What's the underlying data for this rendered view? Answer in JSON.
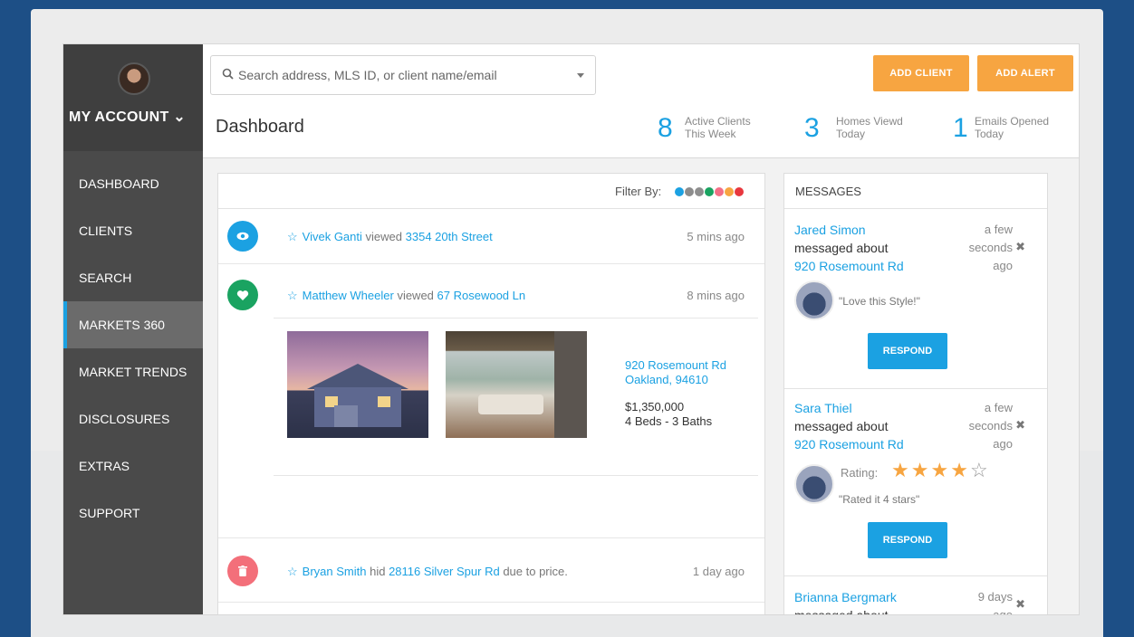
{
  "sidebar": {
    "account_label": "MY ACCOUNT ⌄",
    "items": [
      {
        "label": "DASHBOARD"
      },
      {
        "label": "CLIENTS"
      },
      {
        "label": "SEARCH"
      },
      {
        "label": "MARKETS 360"
      },
      {
        "label": "MARKET TRENDS"
      },
      {
        "label": "DISCLOSURES"
      },
      {
        "label": "EXTRAS"
      },
      {
        "label": "SUPPORT"
      }
    ],
    "active_item": "MARKETS 360"
  },
  "header": {
    "search_placeholder": "Search address, MLS ID, or client name/email",
    "add_client_label": "ADD CLIENT",
    "add_alert_label": "ADD ALERT",
    "page_title": "Dashboard",
    "stats": [
      {
        "value": "8",
        "line1": "Active Clients",
        "line2": "This Week"
      },
      {
        "value": "3",
        "line1": "Homes Viewd",
        "line2": "Today"
      },
      {
        "value": "1",
        "line1": "Emails Opened",
        "line2": "Today"
      }
    ]
  },
  "feed": {
    "filter_label": "Filter By:",
    "filter_colors": [
      "#1ba1e2",
      "#8c8c8c",
      "#8e8e8e",
      "#1aa361",
      "#f36f86",
      "#f7a541",
      "#e8373e"
    ],
    "rows": [
      {
        "name": "Vivek Ganti",
        "action": "viewed",
        "target": "3354 20th Street",
        "suffix": "",
        "time": "5 mins ago",
        "icon": "eye-icon",
        "color": "#1ba1e2"
      },
      {
        "name": "Matthew Wheeler",
        "action": "viewed",
        "target": "67 Rosewood Ln",
        "suffix": "",
        "time": "8 mins ago",
        "icon": "heart-icon",
        "color": "#1aa361"
      },
      {
        "name": "Bryan Smith",
        "action": "hid",
        "target": "28116 Silver Spur Rd",
        "suffix": "due to price.",
        "time": "1 day ago",
        "icon": "trash-icon",
        "color": "#f36f7a"
      }
    ],
    "listing": {
      "address_line1": "920 Rosemount Rd",
      "address_line2": "Oakland, 94610",
      "price": "$1,350,000",
      "details": "4 Beds - 3 Baths"
    }
  },
  "messages": {
    "title": "MESSAGES",
    "items": [
      {
        "name": "Jared Simon",
        "about": "messaged about",
        "address": "920 Rosemount Rd",
        "time_1": "a few",
        "time_2": "seconds",
        "time_3": "ago",
        "quote": "\"Love this Style!\"",
        "respond_label": "RESPOND"
      },
      {
        "name": "Sara Thiel",
        "about": "messaged about",
        "address": "920 Rosemount Rd",
        "time_1": "a few",
        "time_2": "seconds",
        "time_3": "ago",
        "rating_label": "Rating:",
        "rating": 4,
        "rating_max": 5,
        "quote": "\"Rated it 4 stars\"",
        "respond_label": "RESPOND"
      },
      {
        "name": "Brianna Bergmark",
        "about": "messaged about",
        "time_1": "9 days",
        "time_2": "ago"
      }
    ]
  }
}
